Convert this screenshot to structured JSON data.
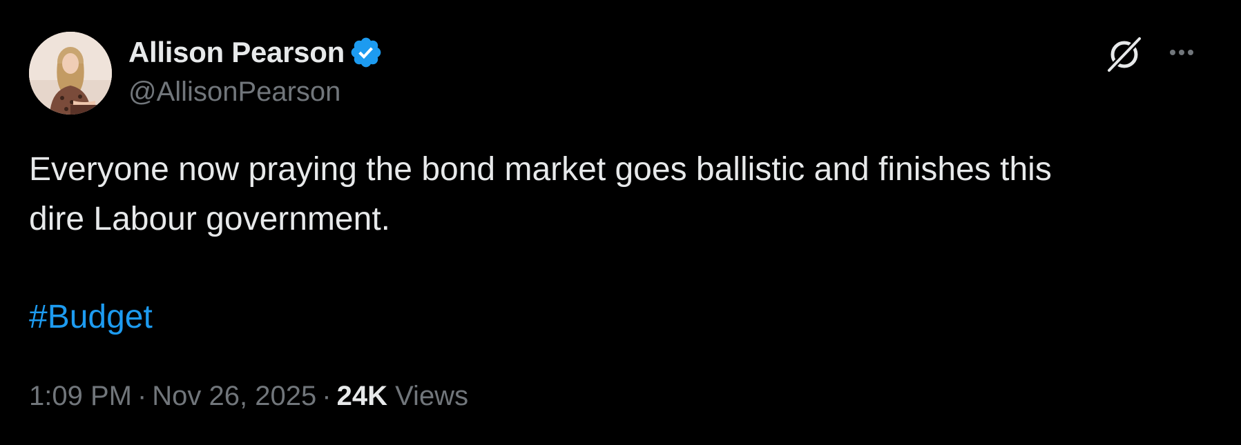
{
  "author": {
    "display_name": "Allison Pearson",
    "handle": "@AllisonPearson",
    "verified": true
  },
  "tweet": {
    "text_lines": [
      "Everyone now praying the bond market goes ballistic and finishes this",
      "dire Labour government."
    ],
    "hashtag": "#Budget",
    "time": "1:09 PM",
    "separator": "·",
    "date": "Nov 26, 2025",
    "views_count": "24K",
    "views_label": "Views"
  },
  "icons": {
    "verified": "verified-badge-icon",
    "grok": "grok-icon",
    "more": "more-options-icon"
  },
  "colors": {
    "background": "#000000",
    "primary_text": "#e7e9ea",
    "secondary_text": "#71767b",
    "link": "#1d9bf0",
    "verified": "#1d9bf0"
  }
}
